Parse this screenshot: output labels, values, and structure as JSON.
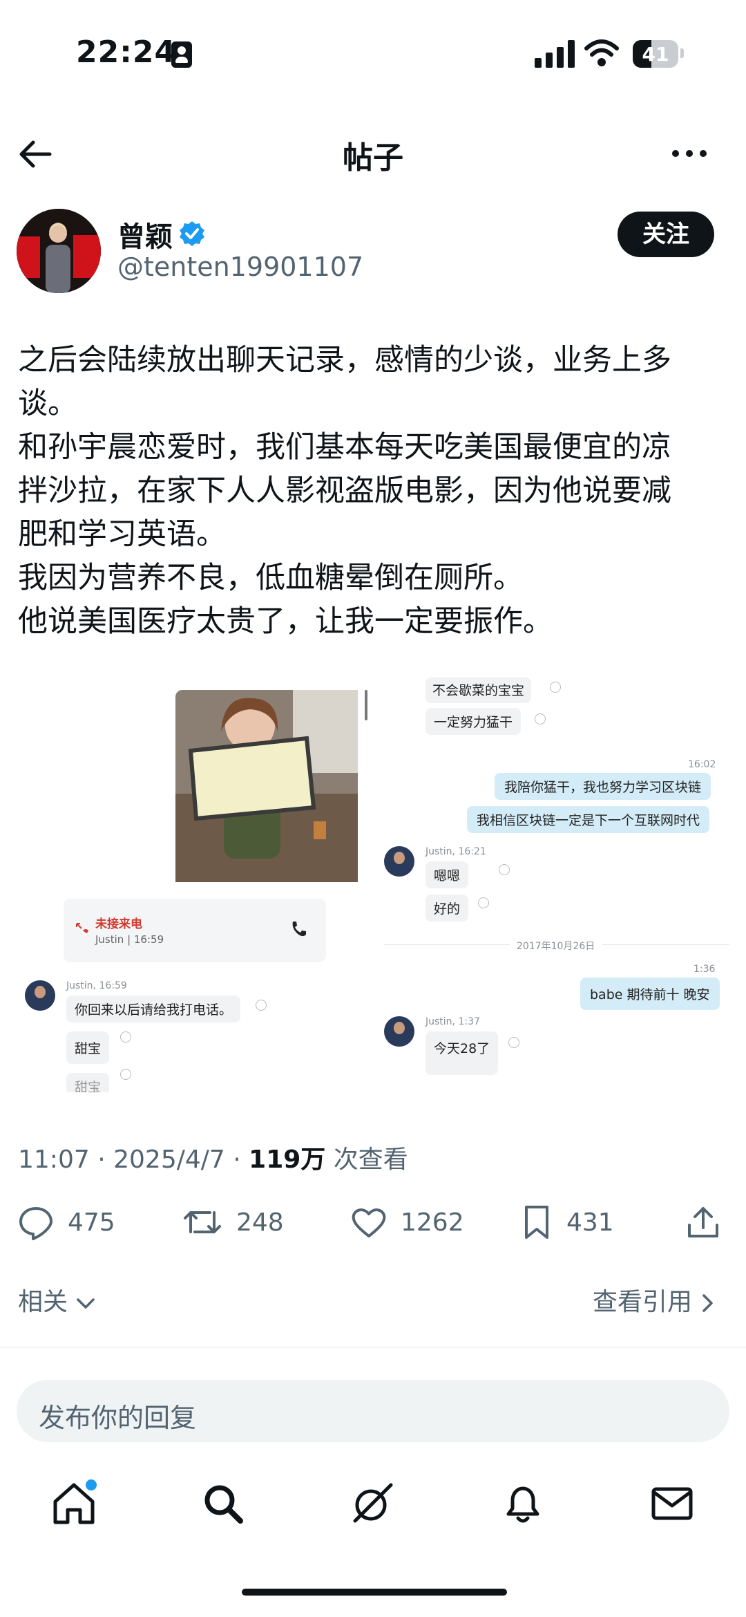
{
  "status_bar": {
    "time": "22:24",
    "battery": "41",
    "battery_level_percent": 41
  },
  "nav": {
    "title": "帖子"
  },
  "author": {
    "name": "曾颖",
    "handle": "@tenten19901107",
    "follow_label": "关注",
    "verified_color": "#1d9bf0"
  },
  "post": {
    "lines": [
      "之后会陆续放出聊天记录，感情的少谈，业务上多",
      "谈。",
      "和孙宇晨恋爱时，我们基本每天吃美国最便宜的凉",
      "拌沙拉，在家下人人影视盗版电影，因为他说要减",
      "肥和学习英语。",
      "我因为营养不良，低血糖晕倒在厕所。",
      "他说美国医疗太贵了，让我一定要振作。"
    ]
  },
  "media": {
    "missed_call": {
      "label": "未接来电",
      "sub": "Justin | 16:59"
    },
    "left_chat": {
      "meta": "Justin, 16:59",
      "messages": [
        "你回来以后请给我打电话。",
        "甜宝",
        "甜宝"
      ]
    },
    "right_chat": {
      "top_messages": [
        "不会歇菜的宝宝",
        "一定努力猛干"
      ],
      "time1": "16:02",
      "out1": "我陪你猛干，我也努力学习区块链",
      "out2": "我相信区块链一定是下一个互联网时代",
      "meta2": "Justin, 16:21",
      "in1": "嗯嗯",
      "in2": "好的",
      "date_divider": "2017年10月26日",
      "time2": "1:36",
      "out3": "babe 期待前十 晚安",
      "meta3": "Justin, 1:37",
      "in3": "今天28了"
    }
  },
  "meta": {
    "time": "11:07",
    "date": "2025/4/7",
    "views": "119万",
    "views_suffix": "次查看",
    "sep": "·"
  },
  "actions": {
    "replies": "475",
    "reposts": "248",
    "likes": "1262",
    "bookmarks": "431"
  },
  "links": {
    "related": "相关",
    "view_quotes": "查看引用"
  },
  "reply": {
    "placeholder": "发布你的回复"
  },
  "tabs": [
    "home-icon",
    "search-icon",
    "grok-icon",
    "notifications-icon",
    "messages-icon"
  ]
}
